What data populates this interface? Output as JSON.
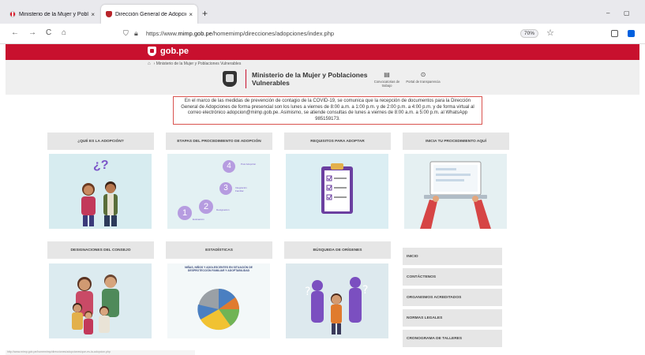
{
  "browser": {
    "tabs": [
      {
        "label": "Ministerio de la Mujer y Poblacio",
        "close": "×"
      },
      {
        "label": "Dirección General de Adopcion",
        "close": "×"
      }
    ],
    "new_tab": "+",
    "window_controls": {
      "minimize": "–",
      "restore": "▢"
    },
    "nav": {
      "back": "←",
      "forward": "→",
      "reload": "C",
      "home": "⌂"
    },
    "url_prefix": "https://www.",
    "url_domain": "mimp.gob.pe",
    "url_path": "/homemimp/direcciones/adopciones/index.php",
    "zoom": "70%",
    "status_url": "http://www.mimp.gob.pe/homemimp/direcciones/adopciones/que-es-la-adopcion.php"
  },
  "gov": {
    "brand": "gob.pe"
  },
  "header": {
    "breadcrumb": "Ministerio de la Mujer y Poblaciones Vulnerables",
    "ministry_name": "Ministerio de la Mujer y Poblaciones Vulnerables",
    "links": [
      {
        "label": "Convocatorias de trabajo",
        "icon": "briefcase-icon"
      },
      {
        "label": "Portal de transparencia",
        "icon": "magnifier-icon"
      }
    ]
  },
  "notice": "En el marco de las medidas de prevención de contagio de la COVID-19, se comunica que la recepción de documentos para la Dirección General de Adopciones de forma presencial son los lunes a viernes de 8:00 a.m. a 1:00 p.m. y de 2:00 p.m. a 4:00 p.m. y de forma virtual al correo electrónico adopcion@mimp.gob.pe. Asimismo, se atiende consultas de lunes a viernes de 8:00 a.m. a 5:00 p.m. al WhatsApp 985159173.",
  "cards_row1": [
    {
      "title": "¿QUÉ ES LA ADOPCIÓN?"
    },
    {
      "title": "ETAPAS DEL PROCEDIMIENTO DE ADOPCIÓN"
    },
    {
      "title": "REQUISITOS PARA ADOPTAR"
    },
    {
      "title": "INICIA TU PROCEDIMIENTO AQUÍ"
    }
  ],
  "cards_row2": [
    {
      "title": "DESIGNACIONES DEL CONSEJO"
    },
    {
      "title": "ESTADÍSTICAS"
    },
    {
      "title": "BÚSQUEDA DE ORÍGENES"
    }
  ],
  "adoption_question": "¿?",
  "stages": [
    {
      "num": "1",
      "label": "Evaluación"
    },
    {
      "num": "2",
      "label": "Designación"
    },
    {
      "num": "3",
      "label": "Integración Familiar"
    },
    {
      "num": "4",
      "label": "Post Adopción"
    }
  ],
  "stats_title": "NIÑAS, NIÑOS Y ADOLESCENTES EN SITUACIÓN DE DESPROTECCIÓN FAMILIAR Y ADOPTABILIDAD",
  "sidebar": [
    {
      "label": "INICIO"
    },
    {
      "label": "CONTÁCTENOS"
    },
    {
      "label": "ORGANISMOS ACREDITADOS"
    },
    {
      "label": "NORMAS LEGALES"
    },
    {
      "label": "CRONOGRAMA DE TALLERES"
    }
  ],
  "colors": {
    "gov_red": "#c8102e",
    "notice_border": "#d9534f",
    "card_bg": "#e6e6e6",
    "illustration_bg": "#d7ecf0",
    "stage_purple": "#b69ce0"
  }
}
